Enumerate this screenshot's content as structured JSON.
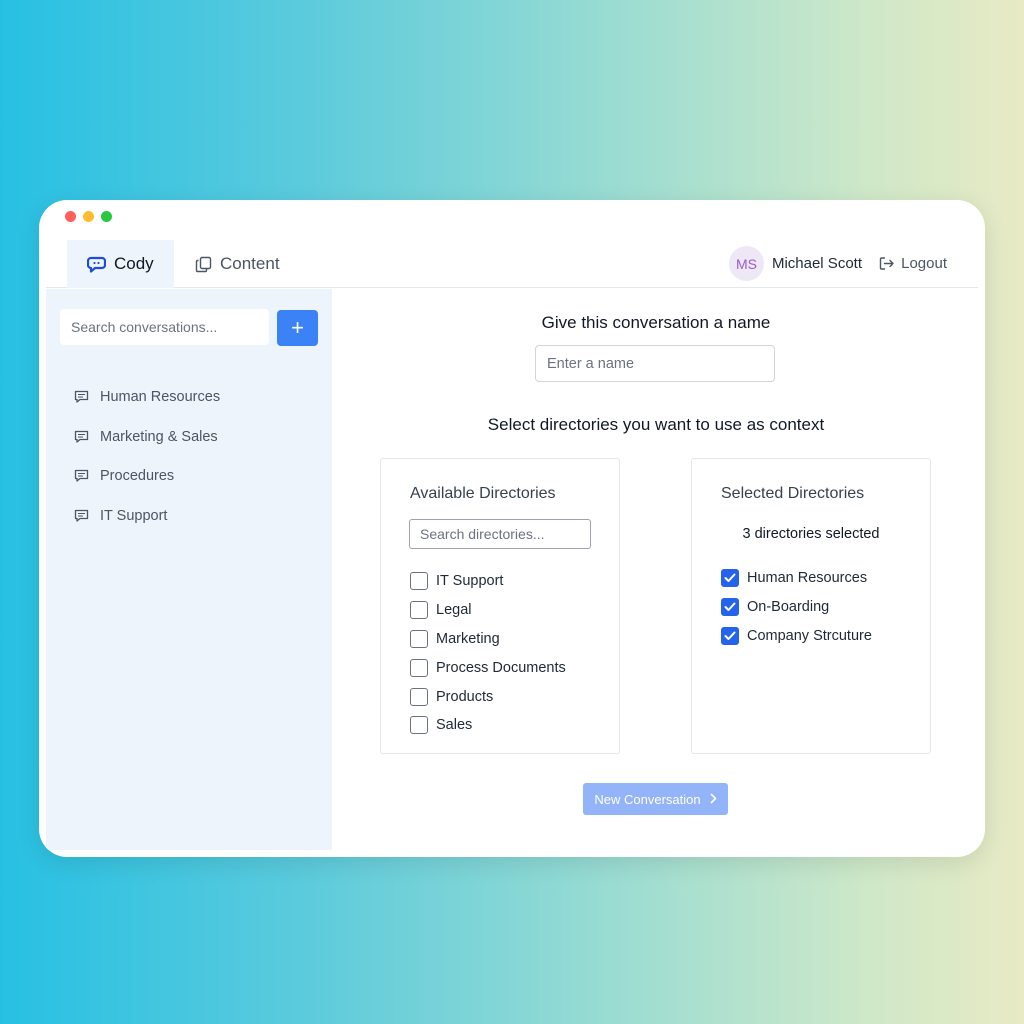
{
  "window": {
    "controls": [
      "close",
      "minimize",
      "maximize"
    ]
  },
  "header": {
    "tabs": [
      {
        "label": "Cody",
        "icon": "chat-bubble-icon",
        "active": true
      },
      {
        "label": "Content",
        "icon": "copy-icon",
        "active": false
      }
    ],
    "user": {
      "initials": "MS",
      "name": "Michael Scott"
    },
    "logout_label": "Logout"
  },
  "sidebar": {
    "search_placeholder": "Search conversations...",
    "add_button_label": "+",
    "conversations": [
      {
        "label": "Human Resources",
        "icon": "message-icon"
      },
      {
        "label": "Marketing & Sales",
        "icon": "message-icon"
      },
      {
        "label": "Procedures",
        "icon": "message-icon"
      },
      {
        "label": "IT Support",
        "icon": "message-icon"
      }
    ]
  },
  "main": {
    "name_heading": "Give this conversation a name",
    "name_placeholder": "Enter a name",
    "context_heading": "Select directories you want to use as context",
    "available": {
      "title": "Available Directories",
      "search_placeholder": "Search directories...",
      "items": [
        {
          "label": "IT Support",
          "checked": false
        },
        {
          "label": "Legal",
          "checked": false
        },
        {
          "label": "Marketing",
          "checked": false
        },
        {
          "label": "Process Documents",
          "checked": false
        },
        {
          "label": "Products",
          "checked": false
        },
        {
          "label": "Sales",
          "checked": false
        }
      ]
    },
    "selected": {
      "title": "Selected Directories",
      "count_text": "3 directories selected",
      "items": [
        {
          "label": "Human Resources",
          "checked": true
        },
        {
          "label": "On-Boarding",
          "checked": true
        },
        {
          "label": "Company Strcuture",
          "checked": true
        }
      ]
    },
    "new_conversation_label": "New Conversation"
  },
  "colors": {
    "accent": "#3b82f6",
    "checkbox_checked": "#2563eb",
    "sidebar_bg": "#eef4fb",
    "button_disabled": "#93b4f8",
    "avatar_bg": "#ede7f6",
    "avatar_text": "#9b5cc9"
  }
}
